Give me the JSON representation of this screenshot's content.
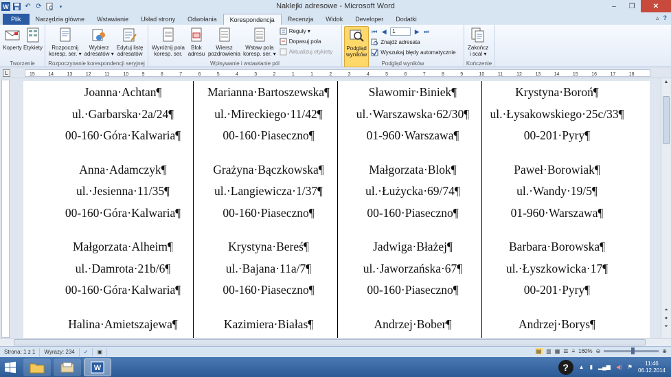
{
  "window": {
    "title": "Naklejki adresowe - Microsoft Word",
    "minimize": "–",
    "restore": "❐",
    "close": "✕"
  },
  "quick_access": [
    "word-app-icon",
    "save-icon",
    "undo-icon",
    "redo-icon",
    "print-preview-icon",
    "customize-icon"
  ],
  "tabs": [
    "Plik",
    "Narzędzia główne",
    "Wstawianie",
    "Układ strony",
    "Odwołania",
    "Korespondencja",
    "Recenzja",
    "Widok",
    "Developer",
    "Dodatki"
  ],
  "active_tab": "Korespondencja",
  "ribbon": {
    "groups": [
      {
        "label": "Tworzenie",
        "buttons": [
          "Koperty",
          "Etykiety"
        ]
      },
      {
        "label": "Rozpoczynanie korespondencji seryjnej",
        "buttons": [
          "Rozpocznij\nkoresp. ser. ▾",
          "Wybierz\nadresatów ▾",
          "Edytuj listę\nadresatów"
        ]
      },
      {
        "label": "Wpisywanie i wstawianie pól",
        "buttons": [
          "Wyróżnij pola\nkoresp. ser.",
          "Blok\nadresu",
          "Wiersz\npozdrowienia",
          "Wstaw pola\nkoresp. ser. ▾"
        ],
        "small": [
          "Reguły ▾",
          "Dopasuj pola",
          "Aktualizuj etykiety"
        ]
      },
      {
        "label": "Podgląd wyników",
        "buttons": [
          "Podgląd\nwyników"
        ],
        "record": "1",
        "small": [
          "Znajdź adresata",
          "Wyszukaj błędy automatycznie"
        ]
      },
      {
        "label": "Kończenie",
        "buttons": [
          "Zakończ\ni scal ▾"
        ]
      }
    ]
  },
  "ruler_ticks": [
    "15",
    "14",
    "13",
    "12",
    "11",
    "10",
    "9",
    "8",
    "7",
    "6",
    "5",
    "4",
    "3",
    "2",
    "1",
    "1",
    "2",
    "3",
    "4",
    "5",
    "6",
    "7",
    "8",
    "9",
    "10",
    "11",
    "12",
    "13",
    "14",
    "15",
    "16",
    "17",
    "18"
  ],
  "labels": [
    [
      [
        "Joanna·Achtan¶",
        "ul.·Garbarska·2a/24¶",
        "00-160·Góra·Kalwaria¶"
      ],
      [
        "Anna·Adamczyk¶",
        "ul.·Jesienna·11/35¶",
        "00-160·Góra·Kalwaria¶"
      ],
      [
        "Małgorzata·Alheim¶",
        "ul.·Damrota·21b/6¶",
        "00-160·Góra·Kalwaria¶"
      ],
      [
        "Halina·Amietszajewa¶"
      ]
    ],
    [
      [
        "Marianna·Bartoszewska¶",
        "ul.·Mireckiego·11/42¶",
        "00-160·Piaseczno¶"
      ],
      [
        "Grażyna·Bączkowska¶",
        "ul.·Langiewicza·1/37¶",
        "00-160·Piaseczno¶"
      ],
      [
        "Krystyna·Bereś¶",
        "ul.·Bajana·11a/7¶",
        "00-160·Piaseczno¶"
      ],
      [
        "Kazimiera·Białas¶"
      ]
    ],
    [
      [
        "Sławomir·Biniek¶",
        "ul.·Warszawska·62/30¶",
        "01-960·Warszawa¶"
      ],
      [
        "Małgorzata·Blok¶",
        "ul.·Łużycka·69/74¶",
        "00-160·Piaseczno¶"
      ],
      [
        "Jadwiga·Błażej¶",
        "ul.·Jaworzańska·67¶",
        "00-160·Piaseczno¶"
      ],
      [
        "Andrzej·Bober¶"
      ]
    ],
    [
      [
        "Krystyna·Boroń¶",
        "ul.·Łysakowskiego·25c/33¶",
        "00-201·Pyry¶"
      ],
      [
        "Paweł·Borowiak¶",
        "ul.·Wandy·19/5¶",
        "01-960·Warszawa¶"
      ],
      [
        "Barbara·Borowska¶",
        "ul.·Łyszkowicka·17¶",
        "00-201·Pyry¶"
      ],
      [
        "Andrzej·Borys¶"
      ]
    ]
  ],
  "status": {
    "page": "Strona: 1 z 1",
    "words": "Wyrazy: 234",
    "zoom": "160%",
    "zoom_level": 0.53
  },
  "taskbar": {
    "time": "11:46",
    "date": "06.12.2014"
  },
  "colors": {
    "accent": "#2a5ba4",
    "highlight": "#ffd86a",
    "close": "#c74a3c"
  }
}
